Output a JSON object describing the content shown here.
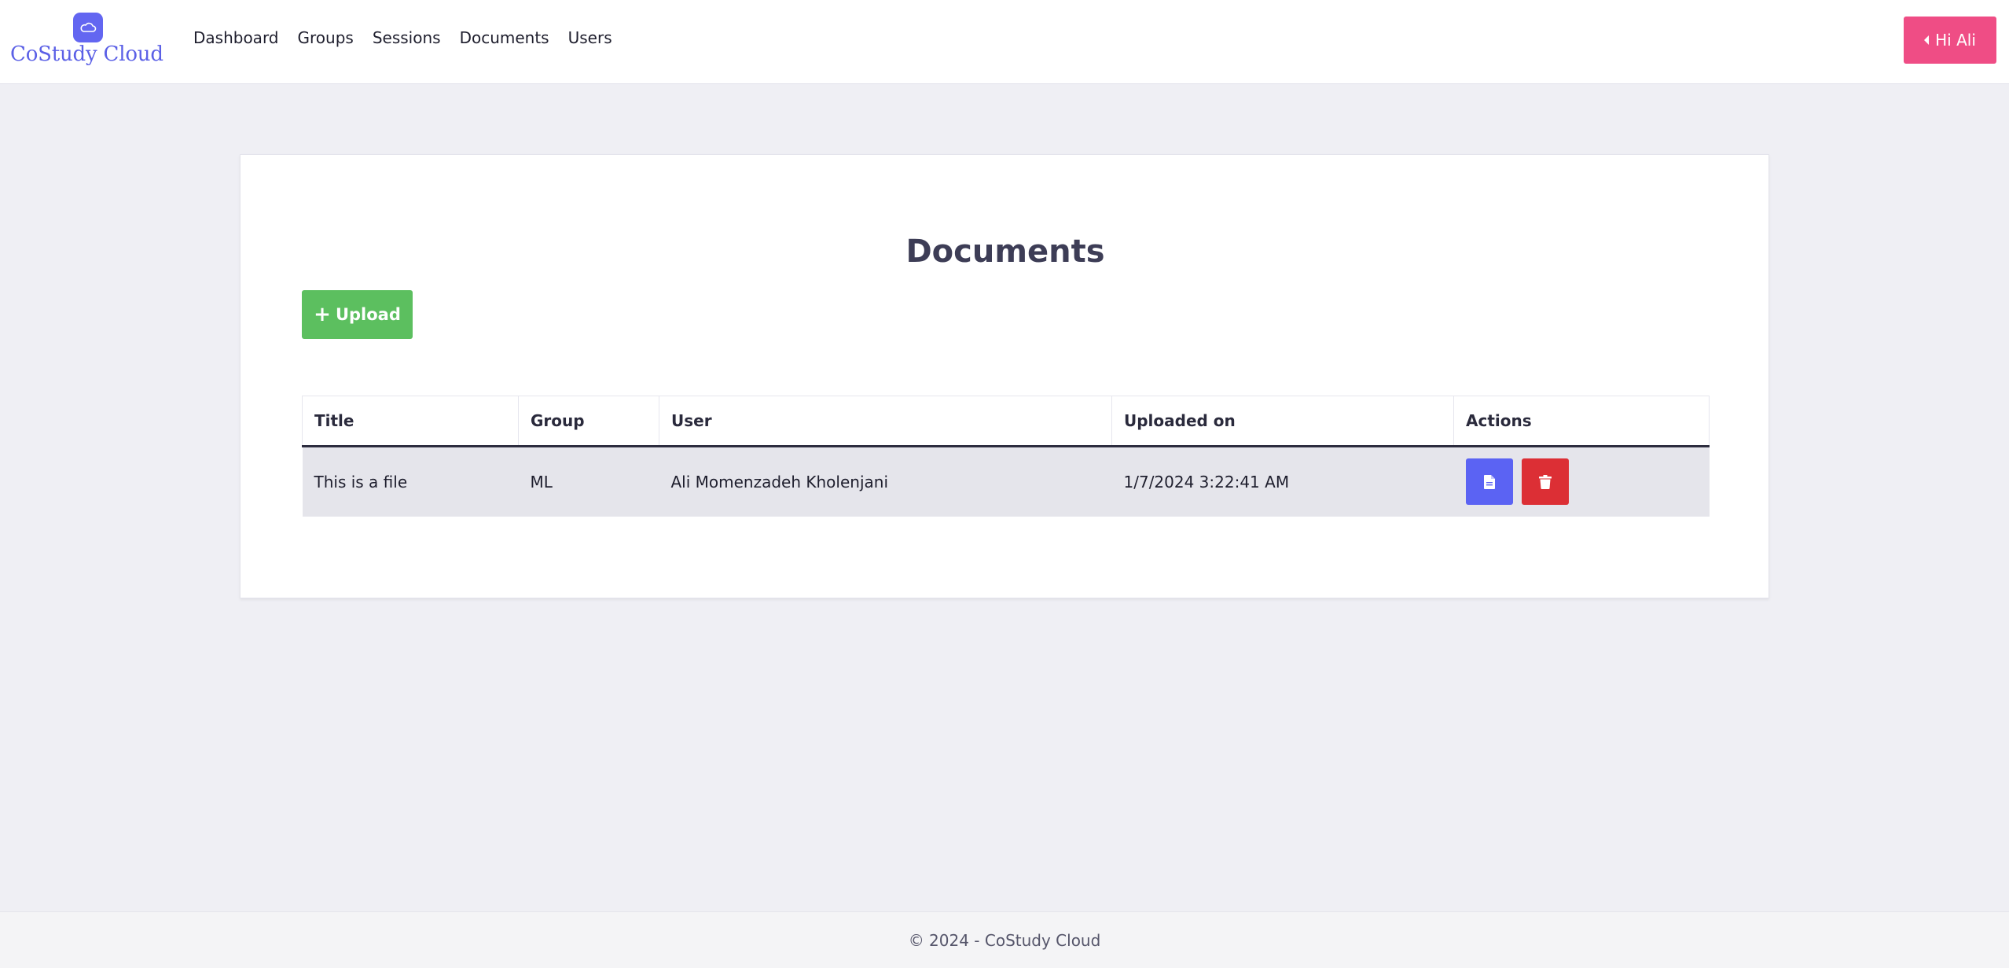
{
  "brand": {
    "name": "CoStudy Cloud",
    "logo_icon": "cloud-icon",
    "color": "#6366f1"
  },
  "nav": {
    "items": [
      {
        "label": "Dashboard"
      },
      {
        "label": "Groups"
      },
      {
        "label": "Sessions"
      },
      {
        "label": "Documents"
      },
      {
        "label": "Users"
      }
    ]
  },
  "user_menu": {
    "label": "Hi Ali",
    "icon": "caret-left-icon",
    "color": "#ef4d85"
  },
  "main": {
    "title": "Documents",
    "upload_button": {
      "label": "Upload",
      "icon": "plus-icon",
      "color": "#5cbf5f"
    },
    "table": {
      "columns": [
        "Title",
        "Group",
        "User",
        "Uploaded on",
        "Actions"
      ],
      "rows": [
        {
          "title": "This is a file",
          "group": "ML",
          "user": "Ali Momenzadeh Kholenjani",
          "uploaded_on": "1/7/2024 3:22:41 AM",
          "actions": [
            {
              "icon": "file-icon",
              "color": "#5b63f3"
            },
            {
              "icon": "trash-icon",
              "color": "#dc2f35"
            }
          ]
        }
      ]
    }
  },
  "footer": {
    "text": "© 2024 - CoStudy Cloud"
  }
}
